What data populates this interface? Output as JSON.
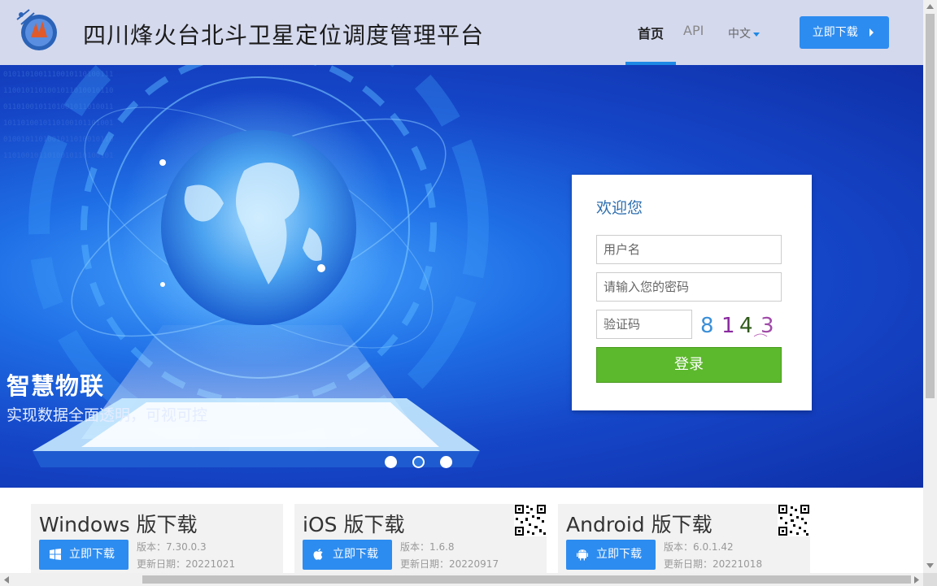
{
  "header": {
    "site_title": "四川烽火台北斗卫星定位调度管理平台",
    "nav": {
      "home": "首页",
      "api": "API",
      "language": "中文"
    },
    "download_button": "立即下载"
  },
  "banner": {
    "slogan": "智慧物联",
    "subslogan": "实现数据全面透明，可视可控",
    "slides": 3,
    "active_slide": 2
  },
  "login": {
    "title": "欢迎您",
    "username_placeholder": "用户名",
    "password_placeholder": "请输入您的密码",
    "captcha_placeholder": "验证码",
    "captcha_chars": [
      "8",
      "1",
      "4",
      "3"
    ],
    "submit_label": "登录"
  },
  "downloads": [
    {
      "title": "Windows 版下载",
      "button": "立即下载",
      "version": "版本：7.30.0.3",
      "date": "更新日期：20221021",
      "icon": "windows-icon"
    },
    {
      "title": "iOS 版下载",
      "button": "立即下载",
      "version": "版本：1.6.8",
      "date": "更新日期：20220917",
      "icon": "apple-icon"
    },
    {
      "title": "Android 版下载",
      "button": "立即下载",
      "version": "版本：6.0.1.42",
      "date": "更新日期：20221018",
      "icon": "android-icon"
    }
  ],
  "colors": {
    "primary": "#2d8cf0",
    "login_button": "#5cb82c",
    "header_bg": "#d4d9ee",
    "banner_bg": "#1546c8"
  }
}
